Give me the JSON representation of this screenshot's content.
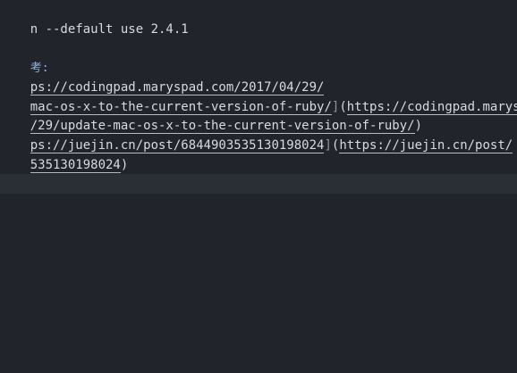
{
  "editor": {
    "line1": "n --default use 2.4.1",
    "line2": "考:",
    "line3_link": "ps://codingpad.maryspad.com/2017/04/29/",
    "line4_link": "mac-os-x-to-the-current-version-of-ruby/",
    "line4_bracket": "]",
    "line4_paren_open": "(",
    "line4_url": "https://codingpad.maryspa",
    "line5_url": "/29/update-mac-os-x-to-the-current-version-of-ruby/",
    "line5_paren_close": ")",
    "line6_link": "ps://juejin.cn/post/6844903535130198024",
    "line6_bracket": "]",
    "line6_paren_open": "(",
    "line6_url": "https://juejin.cn/post/",
    "line7_url": "535130198024",
    "line7_paren_close": ")"
  },
  "colors": {
    "background": "#21252b",
    "text": "#d7dae0",
    "label": "#8fb3d9",
    "current_line": "#2a2e35"
  }
}
